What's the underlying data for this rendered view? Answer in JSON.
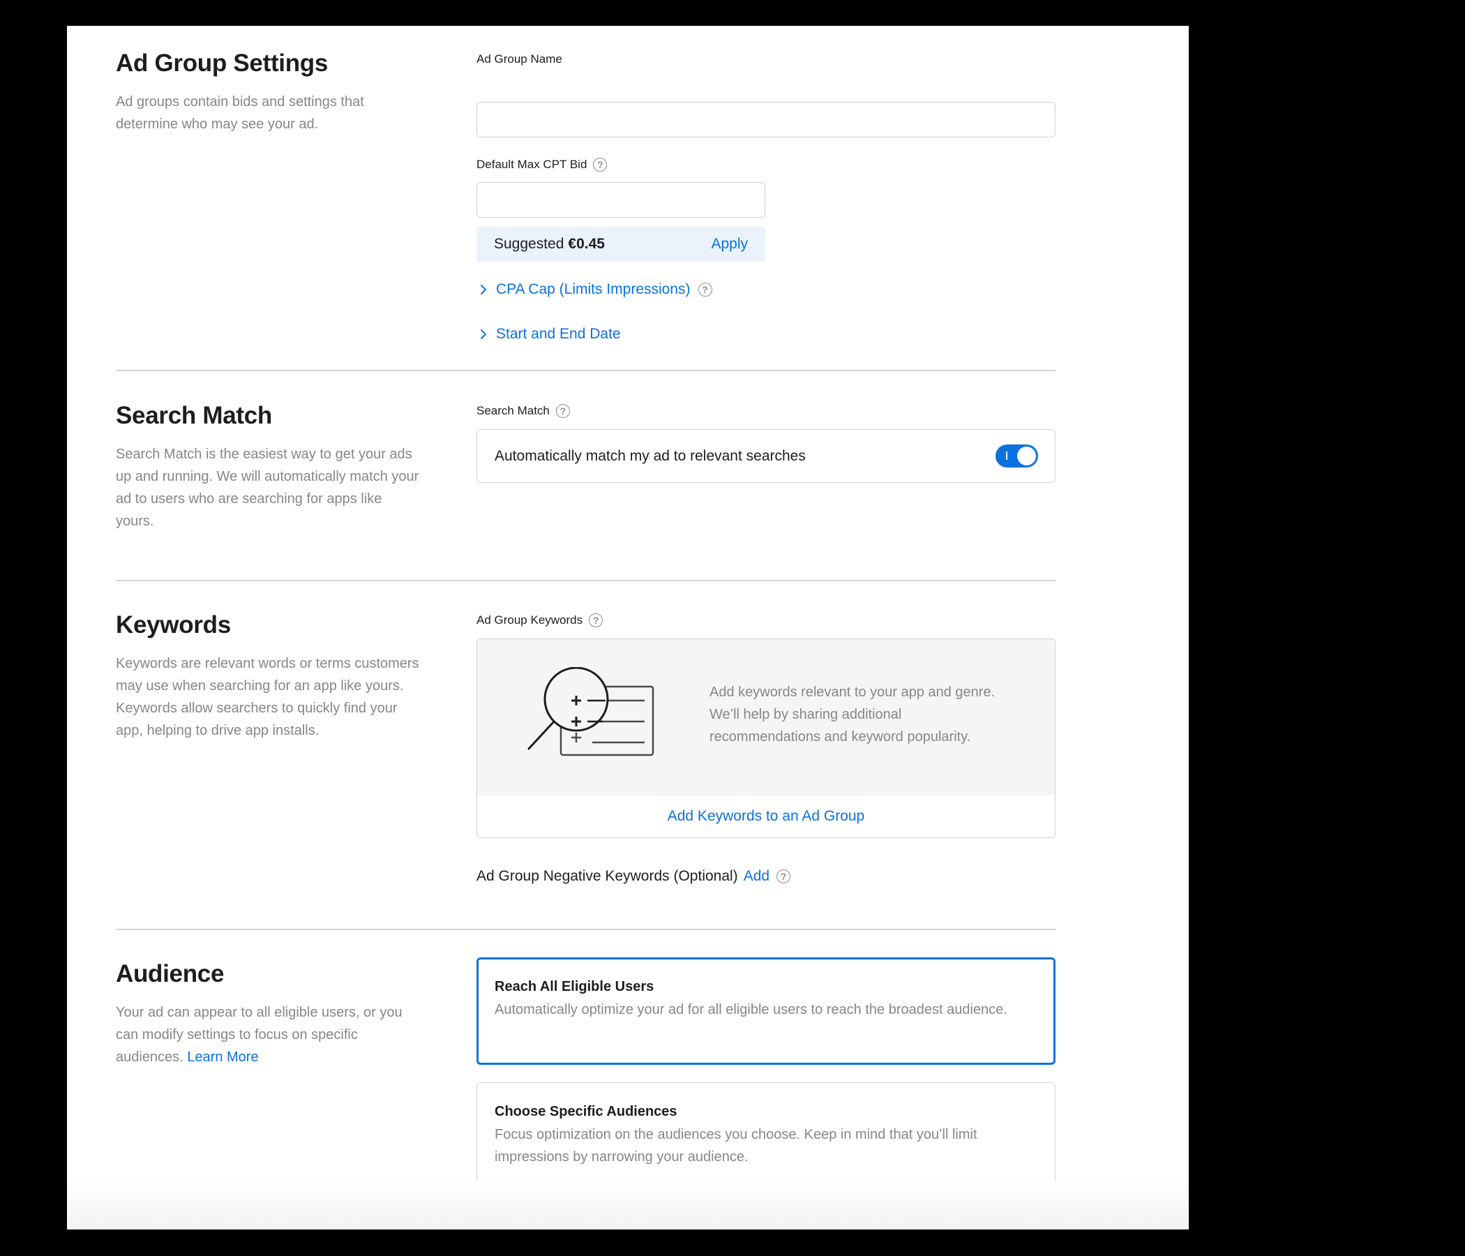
{
  "ad_group_settings": {
    "title": "Ad Group Settings",
    "description": "Ad groups contain bids and settings that determine who may see your ad.",
    "name_label": "Ad Group Name",
    "name_value": "",
    "bid_label": "Default Max CPT Bid",
    "bid_value": "",
    "suggested_label": "Suggested",
    "suggested_value": "€0.45",
    "apply_label": "Apply",
    "cpa_cap_label": "CPA Cap (Limits Impressions)",
    "dates_label": "Start and End Date"
  },
  "search_match": {
    "title": "Search Match",
    "description": "Search Match is the easiest way to get your ads up and running. We will automatically match your ad to users who are searching for apps like yours.",
    "field_label": "Search Match",
    "toggle_text": "Automatically match my ad to relevant searches",
    "toggle_on": true
  },
  "keywords": {
    "title": "Keywords",
    "description": "Keywords are relevant words or terms customers may use when searching for an app like yours. Keywords allow searchers to quickly find your app, helping to drive app installs.",
    "field_label": "Ad Group Keywords",
    "empty_text": "Add keywords relevant to your app and genre. We’ll help by sharing additional recommendations and keyword popularity.",
    "add_button": "Add Keywords to an Ad Group",
    "negative_label": "Ad Group Negative Keywords (Optional)",
    "negative_add": "Add"
  },
  "audience": {
    "title": "Audience",
    "description": "Your ad can appear to all eligible users, or you can modify settings to focus on specific audiences.",
    "learn_more": "Learn More",
    "options": [
      {
        "title": "Reach All Eligible Users",
        "description": "Automatically optimize your ad for all eligible users to reach the broadest audience.",
        "selected": true
      },
      {
        "title": "Choose Specific Audiences",
        "description": "Focus optimization on the audiences you choose. Keep in mind that you’ll limit impressions by narrowing your audience.",
        "selected": false
      }
    ]
  },
  "colors": {
    "accent": "#0a72e0",
    "border": "#d2d2d7",
    "muted_text": "#86868b",
    "suggest_bg": "#eaf2fc"
  },
  "icons": {
    "help": "help-circle-icon",
    "disclosure": "chevron-right-icon",
    "keywords_illustration": "magnifier-list-icon"
  }
}
